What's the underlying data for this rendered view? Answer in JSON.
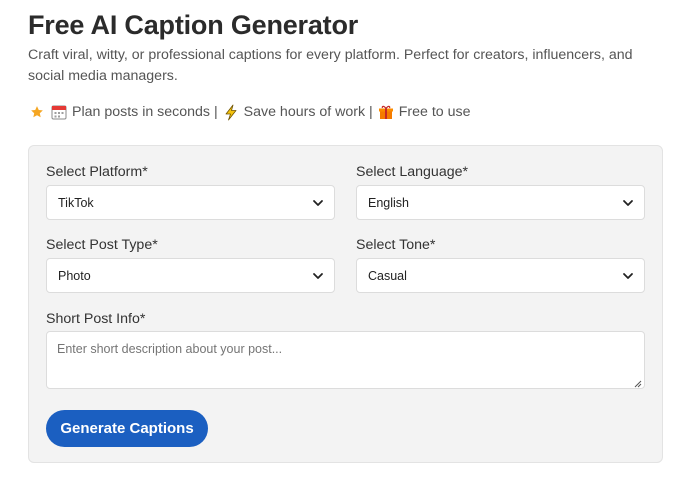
{
  "header": {
    "title": "Free AI Caption Generator",
    "subtitle": "Craft viral, witty, or professional captions for every platform. Perfect for creators, influencers, and social media managers."
  },
  "features": {
    "icons": [
      "star-icon",
      "calendar-icon",
      "lightning-icon",
      "gift-icon"
    ],
    "plan": "Plan posts in seconds |",
    "save": "Save hours of work |",
    "free": "Free to use"
  },
  "form": {
    "platform": {
      "label": "Select Platform*",
      "value": "TikTok"
    },
    "language": {
      "label": "Select Language*",
      "value": "English"
    },
    "post_type": {
      "label": "Select Post Type*",
      "value": "Photo"
    },
    "tone": {
      "label": "Select Tone*",
      "value": "Casual"
    },
    "post_info": {
      "label": "Short Post Info*",
      "placeholder": "Enter short description about your post..."
    },
    "generate_label": "Generate Captions"
  },
  "colors": {
    "accent": "#1b5fc1",
    "card_bg": "#f3f3f3",
    "star": "#f5a623",
    "lightning": "#f4c20d",
    "gift": "#f57c00"
  }
}
